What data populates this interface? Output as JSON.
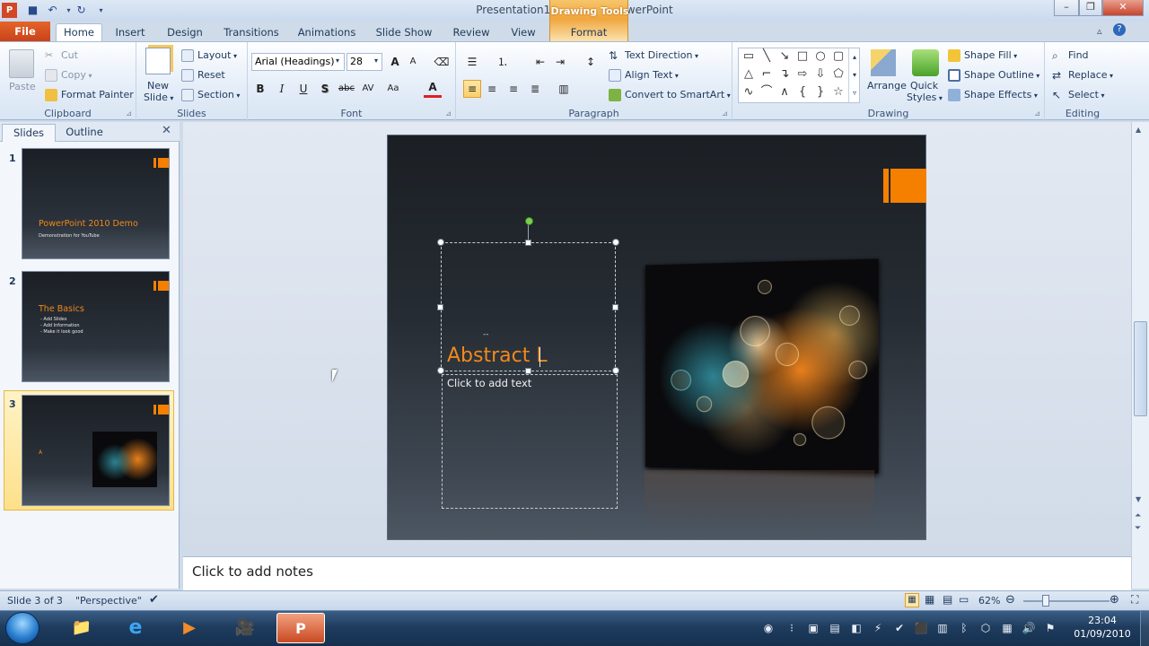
{
  "window": {
    "title": "Presentation1  -  Microsoft PowerPoint",
    "contextual_group": "Drawing Tools"
  },
  "qat": {
    "save_icon": "save-icon",
    "undo_icon": "undo-icon",
    "redo_icon": "redo-icon"
  },
  "tabs": [
    "File",
    "Home",
    "Insert",
    "Design",
    "Transitions",
    "Animations",
    "Slide Show",
    "Review",
    "View",
    "Format"
  ],
  "clipboard": {
    "paste": "Paste",
    "cut": "Cut",
    "copy": "Copy",
    "format_painter": "Format Painter",
    "label": "Clipboard"
  },
  "slides_group": {
    "new_slide_1": "New",
    "new_slide_2": "Slide",
    "layout": "Layout",
    "reset": "Reset",
    "section": "Section",
    "label": "Slides"
  },
  "font": {
    "name": "Arial (Headings)",
    "size": "28",
    "label": "Font",
    "bold": "B",
    "italic": "I",
    "underline": "U",
    "shadow": "S",
    "strike": "abc",
    "spacing": "AV",
    "case": "Aa",
    "color": "A",
    "grow": "A",
    "shrink": "A"
  },
  "paragraph": {
    "text_direction": "Text Direction",
    "align_text": "Align Text",
    "convert_smartart": "Convert to SmartArt",
    "label": "Paragraph"
  },
  "drawing": {
    "arrange": "Arrange",
    "quick_1": "Quick",
    "quick_2": "Styles",
    "shape_fill": "Shape Fill",
    "shape_outline": "Shape Outline",
    "shape_effects": "Shape Effects",
    "label": "Drawing"
  },
  "editing": {
    "find": "Find",
    "replace": "Replace",
    "select": "Select",
    "label": "Editing"
  },
  "pane": {
    "tab_slides": "Slides",
    "tab_outline": "Outline"
  },
  "thumbs": [
    {
      "num": "1",
      "title": "PowerPoint 2010 Demo",
      "sub": "Demonstration for YouTube"
    },
    {
      "num": "2",
      "title": "The Basics",
      "b1": "- Add Slides",
      "b2": "- Add Information",
      "b3": "- Make it look good"
    },
    {
      "num": "3",
      "title": "A"
    }
  ],
  "slide": {
    "title": "Abstract L",
    "body_placeholder": "Click to add text",
    "dash": "--"
  },
  "notes": {
    "placeholder": "Click to add notes"
  },
  "status": {
    "slide_info": "Slide 3 of 3",
    "theme": "\"Perspective\"",
    "zoom": "62%"
  },
  "taskbar": {
    "time": "23:04",
    "date": "01/09/2010"
  },
  "colors": {
    "accent": "#f58000",
    "file_tab": "#d2491c",
    "title_text": "#f0891c"
  }
}
